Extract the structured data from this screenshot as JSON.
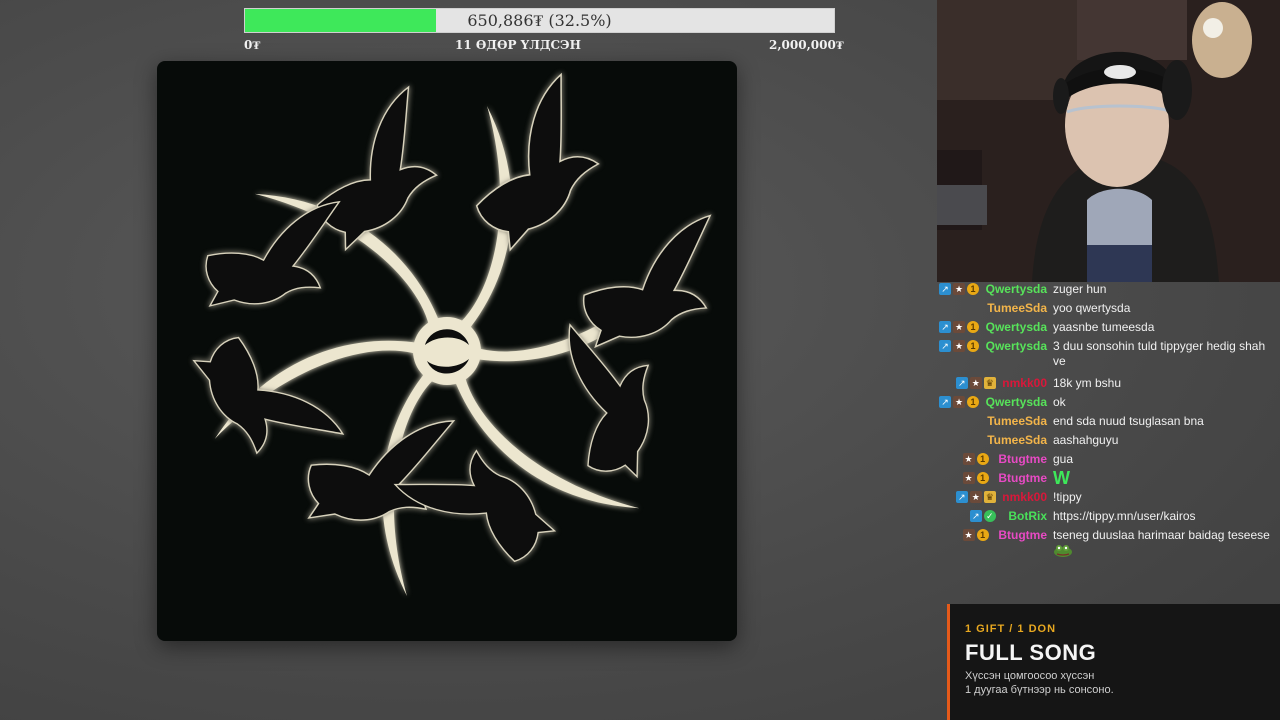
{
  "goal": {
    "current_text": "650,886₮ (32.5%)",
    "progress_fraction": 0.325,
    "min_label": "0₮",
    "center_label": "11 ӨДӨР ҮЛДСЭН",
    "max_label": "2,000,000₮",
    "fill_color": "#3ee85a"
  },
  "chat": {
    "messages": [
      {
        "user": "Qwertysda",
        "user_color": "#57e35a",
        "badges": [
          "arrow-badge",
          "sub-badge",
          "coin-badge"
        ],
        "text": "zuger hun"
      },
      {
        "user": "TumeeSda",
        "user_color": "#f3b54a",
        "badges": [],
        "text": "yoo qwertysda"
      },
      {
        "user": "Qwertysda",
        "user_color": "#57e35a",
        "badges": [
          "arrow-badge",
          "sub-badge",
          "coin-badge"
        ],
        "text": "yaasnbe tumeesda"
      },
      {
        "user": "Qwertysda",
        "user_color": "#57e35a",
        "badges": [
          "arrow-badge",
          "sub-badge",
          "coin-badge"
        ],
        "text": "3 duu sonsohin tuld tippyger hedig shah ve"
      },
      {
        "user": "nmkk00",
        "user_color": "#d9173a",
        "badges": [
          "arrow-badge",
          "sub-badge",
          "crown-badge"
        ],
        "text": "18k ym bshu"
      },
      {
        "user": "Qwertysda",
        "user_color": "#57e35a",
        "badges": [
          "arrow-badge",
          "sub-badge",
          "coin-badge"
        ],
        "text": "ok"
      },
      {
        "user": "TumeeSda",
        "user_color": "#f3b54a",
        "badges": [],
        "text": "end sda nuud tsuglasan bna"
      },
      {
        "user": "TumeeSda",
        "user_color": "#f3b54a",
        "badges": [],
        "text": "aashahguyu"
      },
      {
        "user": "Btugtme",
        "user_color": "#e84ac4",
        "badges": [
          "sub-badge",
          "coin-badge"
        ],
        "text": "gua"
      },
      {
        "user": "Btugtme",
        "user_color": "#e84ac4",
        "badges": [
          "sub-badge",
          "coin-badge"
        ],
        "text": "W"
      },
      {
        "user": "nmkk00",
        "user_color": "#d9173a",
        "badges": [
          "arrow-badge",
          "sub-badge",
          "crown-badge"
        ],
        "text": "!tippy"
      },
      {
        "user": "BotRix",
        "user_color": "#49e05a",
        "badges": [
          "arrow-badge",
          "check-badge"
        ],
        "text": "https://tippy.mn/user/kairos"
      },
      {
        "user": "Btugtme",
        "user_color": "#e84ac4",
        "badges": [
          "sub-badge",
          "coin-badge"
        ],
        "text": "tseneg duuslaa harimaar baidag teseese"
      }
    ]
  },
  "promo": {
    "eyebrow": "1 GIFT / 1 DON",
    "title": "FULL SONG",
    "line1": "Хүссэн цомгоосоо хүссэн",
    "line2": "1 дуугаа бүтнээр нь сонсоно.",
    "accent_color": "#e55a1a",
    "eyebrow_color": "#e8a820"
  },
  "colors": {
    "art_background": "#070b09",
    "art_symbol": "#ece6cf"
  }
}
